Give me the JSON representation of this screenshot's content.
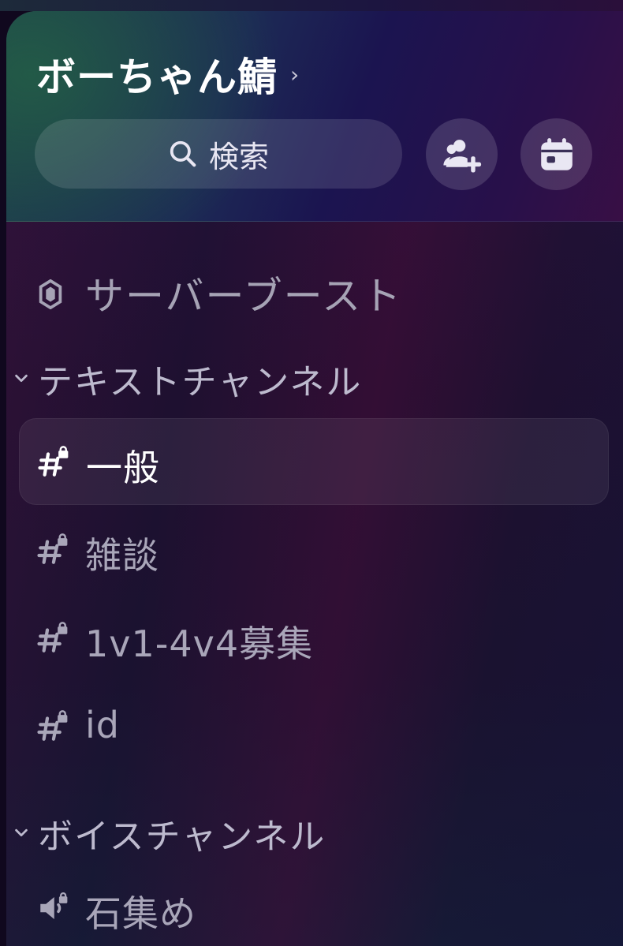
{
  "server": {
    "name": "ボーちゃん鯖",
    "chevron_icon": "chevron-right-icon"
  },
  "search": {
    "label": "検索",
    "icon": "search-icon"
  },
  "header_actions": {
    "invite_icon": "add-user-icon",
    "events_icon": "calendar-icon"
  },
  "boost": {
    "label": "サーバーブースト",
    "icon": "boost-gem-icon"
  },
  "categories": [
    {
      "name": "テキストチャンネル",
      "channels": [
        {
          "name": "一般",
          "type": "text-locked",
          "selected": true
        },
        {
          "name": "雑談",
          "type": "text-locked",
          "selected": false
        },
        {
          "name": "1v1-4v4募集",
          "type": "text-locked",
          "selected": false
        },
        {
          "name": "id",
          "type": "text-locked",
          "selected": false
        }
      ]
    },
    {
      "name": "ボイスチャンネル",
      "channels": [
        {
          "name": "石集め",
          "type": "voice-locked",
          "selected": false
        }
      ]
    }
  ],
  "colors": {
    "selected_text": "#ffffff",
    "muted_text": "#a9a6b9",
    "category_text": "#bdbace"
  }
}
